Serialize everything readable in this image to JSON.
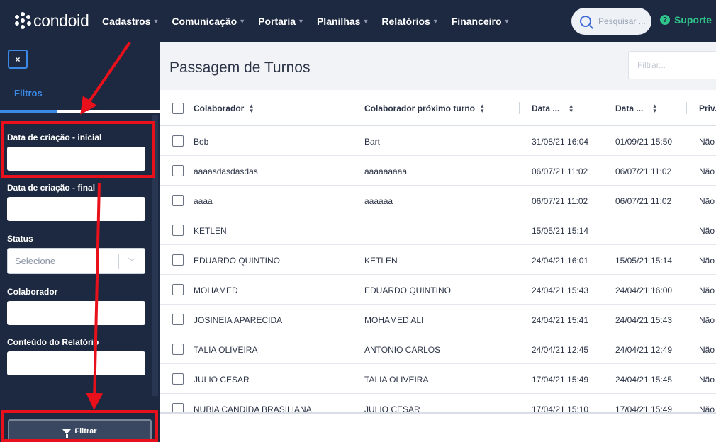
{
  "topbar": {
    "brand": "condoid",
    "nav": [
      {
        "label": "Cadastros"
      },
      {
        "label": "Comunicação"
      },
      {
        "label": "Portaria"
      },
      {
        "label": "Planilhas"
      },
      {
        "label": "Relatórios"
      },
      {
        "label": "Financeiro"
      }
    ],
    "search_placeholder": "Pesquisar ...",
    "support_label": "Suporte"
  },
  "sidebar": {
    "close_label": "×",
    "tab_label": "Filtros",
    "fields": {
      "data_inicial": "Data de criação - inicial",
      "data_final": "Data de criação - final",
      "status": "Status",
      "status_placeholder": "Selecione",
      "colaborador": "Colaborador",
      "conteudo": "Conteúdo do Relatório"
    },
    "filter_button": "Filtrar"
  },
  "main": {
    "title": "Passagem de Turnos",
    "filter_placeholder": "Filtrar..."
  },
  "table": {
    "columns": [
      "Colaborador",
      "Colaborador próximo turno",
      "Data ...",
      "Data ...",
      "Priv..."
    ],
    "rows": [
      [
        "Bob",
        "Bart",
        "31/08/21 16:04",
        "01/09/21 15:50",
        "Não"
      ],
      [
        "aaaasdasdasdas",
        "aaaaaaaaa",
        "06/07/21 11:02",
        "06/07/21 11:02",
        "Não"
      ],
      [
        "aaaa",
        "aaaaaa",
        "06/07/21 11:02",
        "06/07/21 11:02",
        "Não"
      ],
      [
        "KETLEN",
        "",
        "15/05/21 15:14",
        "",
        "Não"
      ],
      [
        "EDUARDO QUINTINO",
        "KETLEN",
        "24/04/21 16:01",
        "15/05/21 15:14",
        "Não"
      ],
      [
        "MOHAMED",
        "EDUARDO QUINTINO",
        "24/04/21 15:43",
        "24/04/21 16:00",
        "Não"
      ],
      [
        "JOSINEIA APARECIDA",
        "MOHAMED ALI",
        "24/04/21 15:41",
        "24/04/21 15:43",
        "Não"
      ],
      [
        "TALIA OLIVEIRA",
        "ANTONIO CARLOS",
        "24/04/21 12:45",
        "24/04/21 12:49",
        "Não"
      ],
      [
        "JULIO CESAR",
        "TALIA OLIVEIRA",
        "17/04/21 15:49",
        "24/04/21 15:45",
        "Não"
      ],
      [
        "NUBIA CANDIDA BRASILIANA",
        "JULIO CESAR",
        "17/04/21 15:10",
        "17/04/21 15:49",
        "Não"
      ]
    ]
  },
  "colors": {
    "nav_bg": "#1d2940",
    "accent": "#3c8ae8",
    "support": "#2fc48a",
    "annotation": "#e8101a"
  }
}
